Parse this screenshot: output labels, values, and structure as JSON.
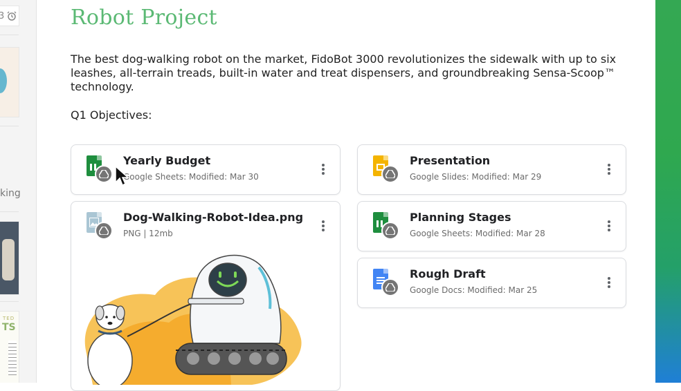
{
  "sidebar": {
    "top_fragment": "3",
    "text_fragment": "king",
    "thumb_text_1": "TED",
    "thumb_text_2": "TS"
  },
  "page": {
    "title": "Robot Project",
    "description": "The best dog-walking robot on the market, FidoBot 3000 revolutionizes the sidewalk with up to six leashes, all-terrain treads, built-in water and treat dispensers, and groundbreaking Sensa-Scoop™ technology.",
    "objectives_label": "Q1 Objectives:"
  },
  "files": [
    {
      "name": "Yearly Budget",
      "meta": "Google Sheets: Modified: Mar 30",
      "icon": "sheets-icon",
      "color": "#1e8e3e"
    },
    {
      "name": "Dog-Walking-Robot-Idea.png",
      "meta": "PNG | 12mb",
      "icon": "image-icon",
      "color": "#8ab4c8"
    },
    {
      "name": "Presentation",
      "meta": "Google Slides: Modified: Mar 29",
      "icon": "slides-icon",
      "color": "#f4b400"
    },
    {
      "name": "Planning Stages",
      "meta": "Google Sheets: Modified: Mar 28",
      "icon": "sheets-icon",
      "color": "#1e8e3e"
    },
    {
      "name": "Rough Draft",
      "meta": "Google Docs: Modified: Mar 25",
      "icon": "docs-icon",
      "color": "#4285f4"
    }
  ],
  "colors": {
    "title": "#5bb974",
    "accent_gradient_top": "#34a853",
    "accent_gradient_bottom": "#1f7fd6"
  }
}
